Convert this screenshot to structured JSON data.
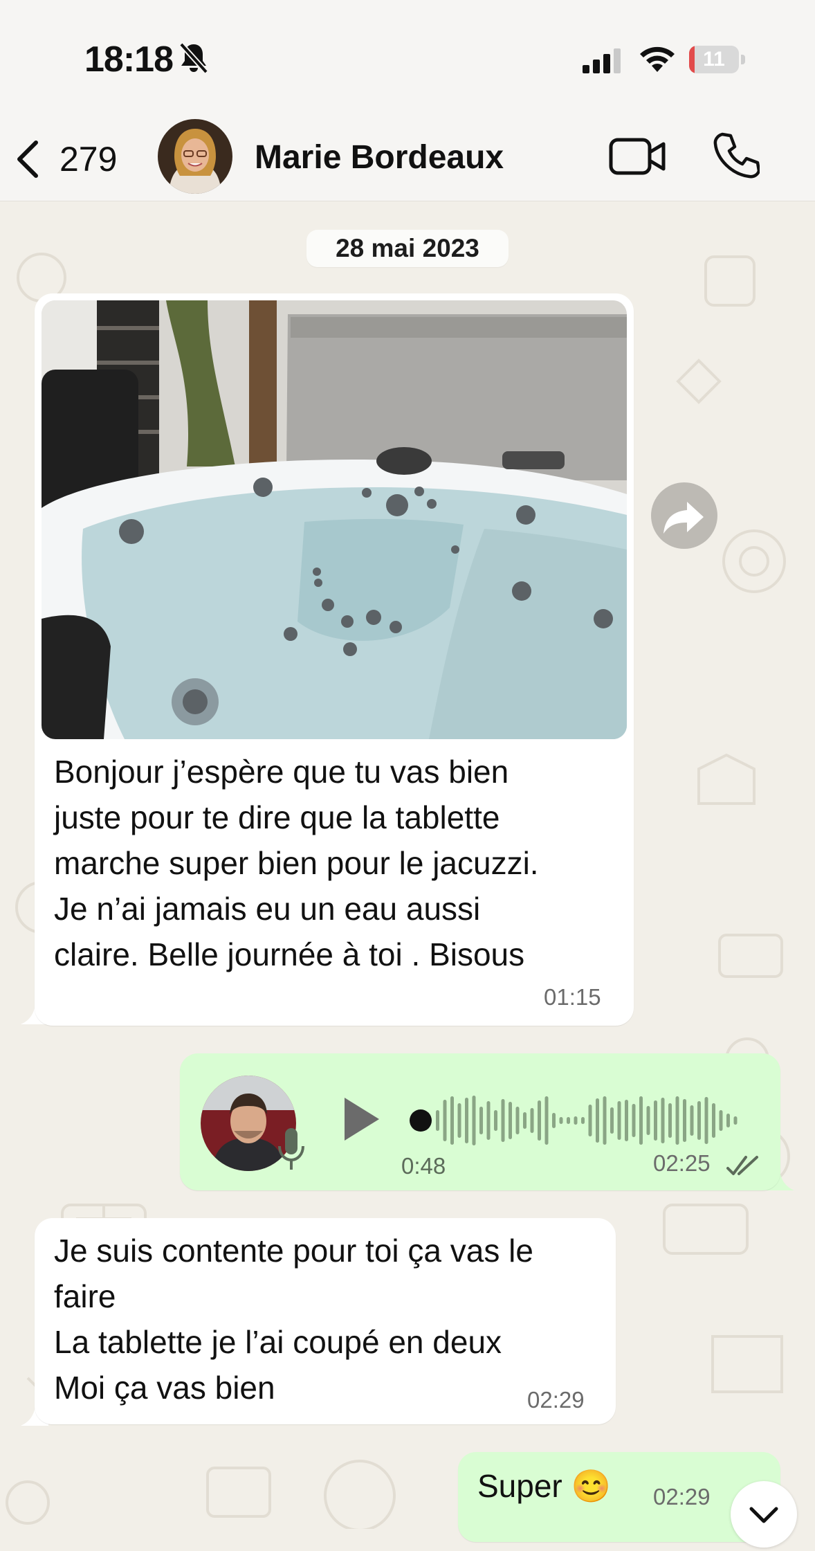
{
  "status_bar": {
    "time": "18:18",
    "battery_level": "11",
    "battery_fraction": 0.11,
    "silent_mode": "bell-slash-icon"
  },
  "header": {
    "back_count": "279",
    "contact_name": "Marie Bordeaux",
    "icons": [
      "chevron-left-icon",
      "video-camera-icon",
      "phone-icon"
    ]
  },
  "chat": {
    "date_chip": "28 mai 2023",
    "messages": [
      {
        "direction": "incoming",
        "type": "image",
        "text": "Bonjour j’espère que tu vas bien\njuste pour te dire que la tablette\nmarche super bien  pour le jacuzzi.\nJe n’ai jamais eu un eau aussi\nclaire. Belle journée à toi . Bisous",
        "time": "01:15"
      },
      {
        "direction": "outgoing",
        "type": "voice",
        "duration": "0:48",
        "time": "02:25",
        "status": "read"
      },
      {
        "direction": "incoming",
        "type": "text",
        "text": "Je suis contente pour toi ça vas le\nfaire\nLa tablette je l’ai coupé en deux\nMoi ça vas bien",
        "time": "02:29"
      },
      {
        "direction": "outgoing",
        "type": "text",
        "text": "Super 😊",
        "time": "02:29"
      }
    ]
  },
  "colors": {
    "chat_background": "#f2efe8",
    "incoming_bubble": "#ffffff",
    "outgoing_bubble": "#d9fdd3",
    "read_ticks": "#5c6b5a"
  }
}
